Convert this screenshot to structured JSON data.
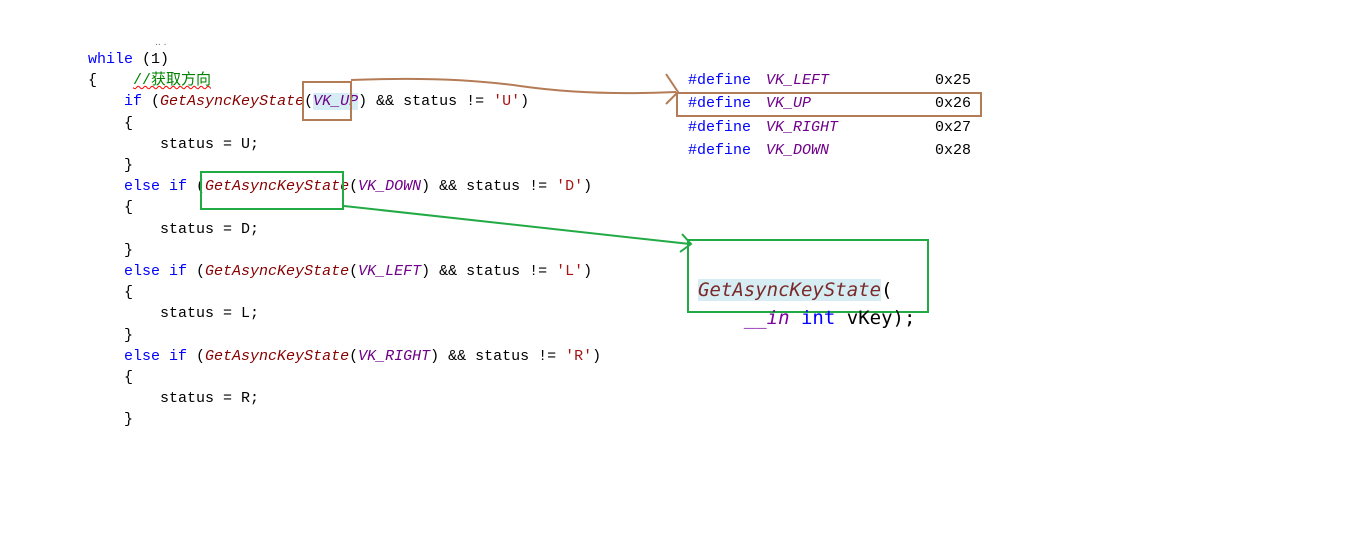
{
  "code_lines": [
    {
      "parts": [
        [
          "kw",
          "while"
        ],
        [
          "plain",
          " (1)"
        ]
      ]
    },
    {
      "parts": [
        [
          "plain",
          "{    "
        ],
        [
          "cmt",
          "//获取方向"
        ]
      ]
    },
    {
      "parts": [
        [
          "plain",
          "    "
        ],
        [
          "kw",
          "if"
        ],
        [
          "plain",
          " ("
        ],
        [
          "fn",
          "GetAsyncKeyState"
        ],
        [
          "plain",
          "("
        ],
        [
          "mac",
          "VK_UP"
        ],
        [
          "plain",
          ") && status != "
        ],
        [
          "str",
          "'U'"
        ],
        [
          "plain",
          ")"
        ]
      ]
    },
    {
      "parts": [
        [
          "plain",
          "    {"
        ]
      ]
    },
    {
      "parts": [
        [
          "plain",
          "        status = U;"
        ]
      ]
    },
    {
      "parts": [
        [
          "plain",
          "    }"
        ]
      ]
    },
    {
      "parts": [
        [
          "plain",
          "    "
        ],
        [
          "kw",
          "else if"
        ],
        [
          "plain",
          " ("
        ],
        [
          "fn",
          "GetAsyncKeyState"
        ],
        [
          "plain",
          "("
        ],
        [
          "mac",
          "VK_DOWN"
        ],
        [
          "plain",
          ") && status != "
        ],
        [
          "str",
          "'D'"
        ],
        [
          "plain",
          ")"
        ]
      ]
    },
    {
      "parts": [
        [
          "plain",
          "    {"
        ]
      ]
    },
    {
      "parts": [
        [
          "plain",
          "        status = D;"
        ]
      ]
    },
    {
      "parts": [
        [
          "plain",
          "    }"
        ]
      ]
    },
    {
      "parts": [
        [
          "plain",
          "    "
        ],
        [
          "kw",
          "else if"
        ],
        [
          "plain",
          " ("
        ],
        [
          "fn",
          "GetAsyncKeyState"
        ],
        [
          "plain",
          "("
        ],
        [
          "mac",
          "VK_LEFT"
        ],
        [
          "plain",
          ") && status != "
        ],
        [
          "str",
          "'L'"
        ],
        [
          "plain",
          ")"
        ]
      ]
    },
    {
      "parts": [
        [
          "plain",
          "    {"
        ]
      ]
    },
    {
      "parts": [
        [
          "plain",
          "        status = L;"
        ]
      ]
    },
    {
      "parts": [
        [
          "plain",
          "    }"
        ]
      ]
    },
    {
      "parts": [
        [
          "plain",
          "    "
        ],
        [
          "kw",
          "else if"
        ],
        [
          "plain",
          " ("
        ],
        [
          "fn",
          "GetAsyncKeyState"
        ],
        [
          "plain",
          "("
        ],
        [
          "mac",
          "VK_RIGHT"
        ],
        [
          "plain",
          ") && status != "
        ],
        [
          "str",
          "'R'"
        ],
        [
          "plain",
          ")"
        ]
      ]
    },
    {
      "parts": [
        [
          "plain",
          "    {"
        ]
      ]
    },
    {
      "parts": [
        [
          "plain",
          "        status = R;"
        ]
      ]
    },
    {
      "parts": [
        [
          "plain",
          "    }"
        ]
      ]
    }
  ],
  "defines": [
    {
      "directive": "#define",
      "name": "VK_LEFT",
      "value": "0x25"
    },
    {
      "directive": "#define",
      "name": "VK_UP",
      "value": "0x26"
    },
    {
      "directive": "#define",
      "name": "VK_RIGHT",
      "value": "0x27"
    },
    {
      "directive": "#define",
      "name": "VK_DOWN",
      "value": "0x28"
    }
  ],
  "signature": {
    "func": "GetAsyncKeyState",
    "open": "(",
    "annotation": "__in",
    "type": "int",
    "param": "vKey",
    "close": ");"
  },
  "colors": {
    "brown": "#b47c56",
    "green": "#22aa44",
    "keyword": "#0000ff",
    "function": "#880000",
    "macro": "#6f008a"
  }
}
